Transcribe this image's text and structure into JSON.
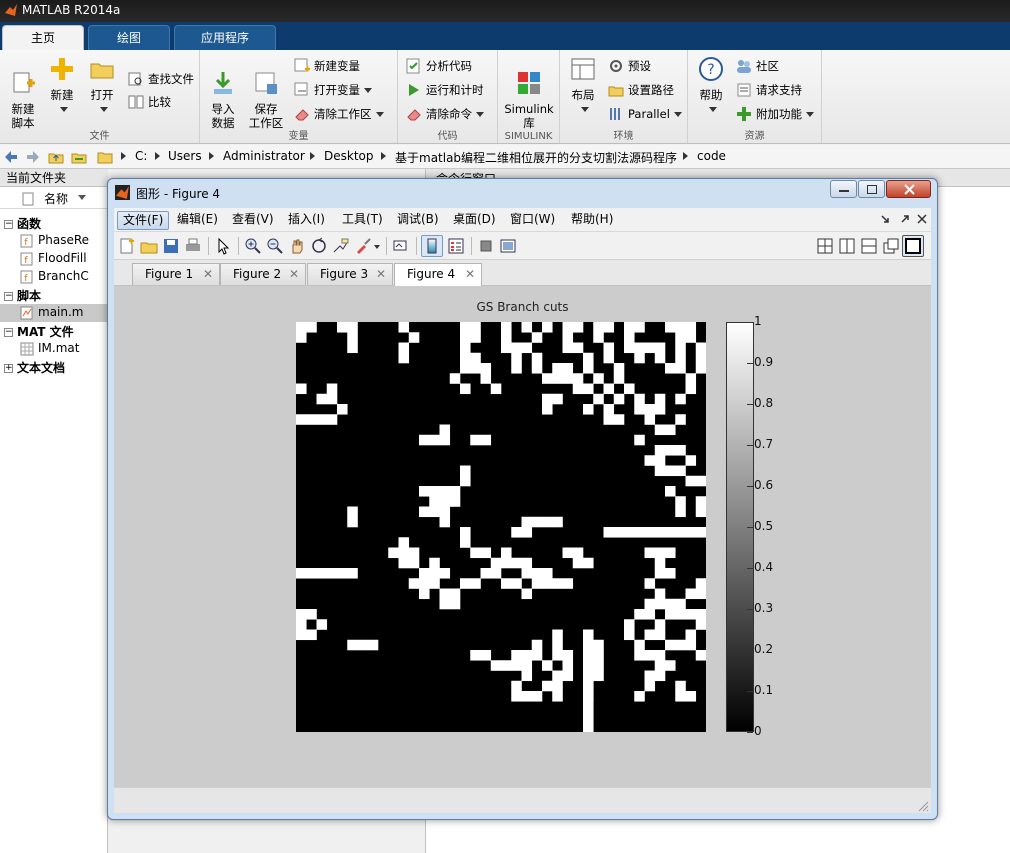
{
  "app": {
    "title": "MATLAB R2014a"
  },
  "ribbon": {
    "tabs": [
      {
        "label": "主页",
        "active": true
      },
      {
        "label": "绘图",
        "active": false
      },
      {
        "label": "应用程序",
        "active": false
      }
    ],
    "groups": {
      "file": {
        "label": "文件",
        "new_script": "新建\n脚本",
        "new": "新建",
        "open": "打开",
        "find_files": "查找文件",
        "compare": "比较"
      },
      "variable": {
        "label": "变量",
        "import": "导入\n数据",
        "save_ws": "保存\n工作区",
        "new_var": "新建变量",
        "open_var": "打开变量",
        "clear_ws": "清除工作区"
      },
      "code": {
        "label": "代码",
        "analyze": "分析代码",
        "run_time": "运行和计时",
        "clear_cmd": "清除命令"
      },
      "simulink": {
        "label": "SIMULINK",
        "lib": "Simulink\n库"
      },
      "env": {
        "label": "环境",
        "layout": "布局",
        "prefs": "预设",
        "set_path": "设置路径",
        "parallel": "Parallel"
      },
      "resources": {
        "label": "资源",
        "help": "帮助",
        "community": "社区",
        "support": "请求支持",
        "addons": "附加功能"
      }
    }
  },
  "address": {
    "crumbs": [
      "C:",
      "Users",
      "Administrator",
      "Desktop",
      "基于matlab编程二维相位展开的分支切割法源码程序",
      "code"
    ]
  },
  "file_panel": {
    "title": "当前文件夹",
    "col_name": "名称",
    "sections": [
      {
        "label": "函数",
        "files": [
          "PhaseRe",
          "FloodFill",
          "BranchC"
        ]
      },
      {
        "label": "脚本",
        "files": [
          "main.m"
        ]
      },
      {
        "label": "MAT 文件",
        "files": [
          "IM.mat"
        ]
      },
      {
        "label": "文本文档",
        "files": []
      }
    ]
  },
  "command_window": {
    "title": "命令行窗口"
  },
  "figure": {
    "window_title": "图形 - Figure 4",
    "menu": [
      "文件(F)",
      "编辑(E)",
      "查看(V)",
      "插入(I)",
      "工具(T)",
      "调试(B)",
      "桌面(D)",
      "窗口(W)",
      "帮助(H)"
    ],
    "tabs": [
      {
        "label": "Figure 1",
        "active": false
      },
      {
        "label": "Figure 2",
        "active": false
      },
      {
        "label": "Figure 3",
        "active": false
      },
      {
        "label": "Figure 4",
        "active": true
      }
    ],
    "plot_title": "GS Branch cuts"
  },
  "chart_data": {
    "type": "heatmap",
    "title": "GS Branch cuts",
    "colormap": "gray",
    "colorbar_ticks": [
      "0",
      "0.1",
      "0.2",
      "0.3",
      "0.4",
      "0.5",
      "0.6",
      "0.7",
      "0.8",
      "0.9",
      "1"
    ],
    "clim": [
      0,
      1
    ],
    "grid_size": 40,
    "white_cells": [
      [
        1,
        1
      ],
      [
        1,
        2
      ],
      [
        2,
        1
      ],
      [
        1,
        5
      ],
      [
        1,
        6
      ],
      [
        1,
        11
      ],
      [
        2,
        12
      ],
      [
        3,
        11
      ],
      [
        4,
        11
      ],
      [
        3,
        6
      ],
      [
        2,
        6
      ],
      [
        1,
        17
      ],
      [
        2,
        17
      ],
      [
        3,
        17
      ],
      [
        4,
        17
      ],
      [
        2,
        18
      ],
      [
        1,
        21
      ],
      [
        2,
        21
      ],
      [
        3,
        21
      ],
      [
        1,
        23
      ],
      [
        1,
        27
      ],
      [
        2,
        27
      ],
      [
        3,
        27
      ],
      [
        1,
        28
      ],
      [
        1,
        30
      ],
      [
        2,
        30
      ],
      [
        3,
        31
      ],
      [
        1,
        31
      ],
      [
        1,
        33
      ],
      [
        2,
        33
      ],
      [
        3,
        33
      ],
      [
        1,
        34
      ],
      [
        1,
        37
      ],
      [
        1,
        38
      ],
      [
        2,
        38
      ],
      [
        3,
        38
      ],
      [
        1,
        39
      ],
      [
        2,
        39
      ],
      [
        1,
        25
      ],
      [
        2,
        24
      ],
      [
        1,
        18
      ],
      [
        3,
        22
      ],
      [
        3,
        23
      ],
      [
        4,
        22
      ],
      [
        3,
        28
      ],
      [
        4,
        29
      ],
      [
        5,
        29
      ],
      [
        4,
        31
      ],
      [
        5,
        32
      ],
      [
        3,
        34
      ],
      [
        4,
        34
      ],
      [
        3,
        35
      ],
      [
        4,
        36
      ],
      [
        3,
        36
      ],
      [
        5,
        37
      ],
      [
        4,
        38
      ],
      [
        5,
        38
      ],
      [
        5,
        40
      ],
      [
        4,
        40
      ],
      [
        3,
        40
      ],
      [
        6,
        39
      ],
      [
        5,
        17
      ],
      [
        4,
        18
      ],
      [
        5,
        18
      ],
      [
        5,
        19
      ],
      [
        6,
        19
      ],
      [
        7,
        20
      ],
      [
        5,
        24
      ],
      [
        6,
        25
      ],
      [
        5,
        26
      ],
      [
        6,
        26
      ],
      [
        6,
        27
      ],
      [
        5,
        27
      ],
      [
        6,
        28
      ],
      [
        7,
        28
      ],
      [
        5,
        22
      ],
      [
        4,
        24
      ],
      [
        7,
        1
      ],
      [
        8,
        3
      ],
      [
        8,
        4
      ],
      [
        9,
        5
      ],
      [
        7,
        4
      ],
      [
        6,
        16
      ],
      [
        7,
        17
      ],
      [
        8,
        25
      ],
      [
        8,
        26
      ],
      [
        9,
        25
      ],
      [
        7,
        31
      ],
      [
        8,
        32
      ],
      [
        8,
        34
      ],
      [
        9,
        35
      ],
      [
        8,
        36
      ],
      [
        9,
        36
      ],
      [
        7,
        33
      ],
      [
        8,
        38
      ],
      [
        7,
        39
      ],
      [
        6,
        32
      ],
      [
        7,
        29
      ],
      [
        8,
        30
      ],
      [
        6,
        30
      ],
      [
        10,
        1
      ],
      [
        10,
        2
      ],
      [
        10,
        3
      ],
      [
        10,
        4
      ],
      [
        9,
        29
      ],
      [
        9,
        31
      ],
      [
        10,
        31
      ],
      [
        10,
        32
      ],
      [
        9,
        34
      ],
      [
        10,
        35
      ],
      [
        11,
        36
      ],
      [
        11,
        37
      ],
      [
        10,
        38
      ],
      [
        12,
        13
      ],
      [
        12,
        14
      ],
      [
        12,
        15
      ],
      [
        11,
        15
      ],
      [
        12,
        18
      ],
      [
        12,
        19
      ],
      [
        12,
        34
      ],
      [
        13,
        36
      ],
      [
        13,
        37
      ],
      [
        14,
        35
      ],
      [
        14,
        36
      ],
      [
        13,
        38
      ],
      [
        14,
        39
      ],
      [
        15,
        36
      ],
      [
        15,
        37
      ],
      [
        15,
        38
      ],
      [
        16,
        39
      ],
      [
        16,
        40
      ],
      [
        15,
        17
      ],
      [
        16,
        17
      ],
      [
        17,
        14
      ],
      [
        17,
        15
      ],
      [
        17,
        16
      ],
      [
        18,
        14
      ],
      [
        18,
        15
      ],
      [
        17,
        13
      ],
      [
        18,
        16
      ],
      [
        19,
        14
      ],
      [
        19,
        13
      ],
      [
        17,
        37
      ],
      [
        18,
        38
      ],
      [
        19,
        38
      ],
      [
        18,
        40
      ],
      [
        19,
        40
      ],
      [
        19,
        6
      ],
      [
        20,
        6
      ],
      [
        19,
        15
      ],
      [
        20,
        15
      ],
      [
        20,
        23
      ],
      [
        20,
        24
      ],
      [
        20,
        25
      ],
      [
        20,
        26
      ],
      [
        21,
        22
      ],
      [
        21,
        23
      ],
      [
        21,
        17
      ],
      [
        22,
        17
      ],
      [
        21,
        31
      ],
      [
        21,
        32
      ],
      [
        21,
        33
      ],
      [
        21,
        34
      ],
      [
        21,
        35
      ],
      [
        21,
        36
      ],
      [
        21,
        37
      ],
      [
        21,
        38
      ],
      [
        21,
        39
      ],
      [
        21,
        40
      ],
      [
        22,
        11
      ],
      [
        23,
        11
      ],
      [
        23,
        12
      ],
      [
        23,
        10
      ],
      [
        24,
        11
      ],
      [
        24,
        12
      ],
      [
        23,
        18
      ],
      [
        23,
        19
      ],
      [
        23,
        21
      ],
      [
        23,
        27
      ],
      [
        23,
        28
      ],
      [
        24,
        28
      ],
      [
        24,
        29
      ],
      [
        24,
        21
      ],
      [
        24,
        20
      ],
      [
        25,
        19
      ],
      [
        24,
        22
      ],
      [
        24,
        23
      ],
      [
        23,
        35
      ],
      [
        23,
        36
      ],
      [
        23,
        37
      ],
      [
        24,
        36
      ],
      [
        25,
        36
      ],
      [
        25,
        37
      ],
      [
        25,
        13
      ],
      [
        26,
        13
      ],
      [
        26,
        14
      ],
      [
        27,
        13
      ],
      [
        25,
        14
      ],
      [
        25,
        24
      ],
      [
        26,
        24
      ],
      [
        26,
        25
      ],
      [
        25,
        25
      ],
      [
        25,
        23
      ],
      [
        26,
        18
      ],
      [
        26,
        17
      ],
      [
        27,
        16
      ],
      [
        27,
        15
      ],
      [
        28,
        16
      ],
      [
        28,
        15
      ],
      [
        26,
        12
      ],
      [
        25,
        15
      ],
      [
        24,
        14
      ],
      [
        25,
        1
      ],
      [
        25,
        2
      ],
      [
        25,
        3
      ],
      [
        25,
        4
      ],
      [
        25,
        5
      ],
      [
        25,
        6
      ],
      [
        26,
        21
      ],
      [
        25,
        20
      ],
      [
        26,
        22
      ],
      [
        27,
        23
      ],
      [
        26,
        26
      ],
      [
        26,
        27
      ],
      [
        27,
        39
      ],
      [
        26,
        40
      ],
      [
        27,
        40
      ],
      [
        26,
        35
      ],
      [
        27,
        36
      ],
      [
        28,
        36
      ],
      [
        29,
        1
      ],
      [
        29,
        2
      ],
      [
        30,
        1
      ],
      [
        31,
        1
      ],
      [
        31,
        2
      ],
      [
        30,
        3
      ],
      [
        28,
        35
      ],
      [
        29,
        35
      ],
      [
        28,
        37
      ],
      [
        29,
        37
      ],
      [
        29,
        38
      ],
      [
        29,
        39
      ],
      [
        29,
        40
      ],
      [
        30,
        40
      ],
      [
        28,
        38
      ],
      [
        29,
        34
      ],
      [
        30,
        33
      ],
      [
        31,
        33
      ],
      [
        30,
        36
      ],
      [
        31,
        36
      ],
      [
        31,
        35
      ],
      [
        32,
        6
      ],
      [
        32,
        7
      ],
      [
        32,
        8
      ],
      [
        32,
        29
      ],
      [
        31,
        29
      ],
      [
        32,
        30
      ],
      [
        33,
        29
      ],
      [
        33,
        30
      ],
      [
        31,
        26
      ],
      [
        32,
        26
      ],
      [
        33,
        24
      ],
      [
        32,
        24
      ],
      [
        33,
        23
      ],
      [
        33,
        22
      ],
      [
        34,
        22
      ],
      [
        34,
        21
      ],
      [
        34,
        20
      ],
      [
        33,
        19
      ],
      [
        33,
        18
      ],
      [
        32,
        34
      ],
      [
        33,
        34
      ],
      [
        33,
        35
      ],
      [
        33,
        36
      ],
      [
        34,
        36
      ],
      [
        34,
        37
      ],
      [
        32,
        38
      ],
      [
        32,
        39
      ],
      [
        33,
        40
      ],
      [
        32,
        37
      ],
      [
        31,
        39
      ],
      [
        34,
        27
      ],
      [
        35,
        27
      ],
      [
        33,
        26
      ],
      [
        34,
        23
      ],
      [
        35,
        23
      ],
      [
        35,
        26
      ],
      [
        34,
        25
      ],
      [
        33,
        27
      ],
      [
        36,
        26
      ],
      [
        37,
        26
      ],
      [
        36,
        25
      ],
      [
        37,
        23
      ],
      [
        37,
        24
      ],
      [
        36,
        22
      ],
      [
        37,
        22
      ],
      [
        35,
        30
      ],
      [
        36,
        29
      ],
      [
        37,
        29
      ],
      [
        34,
        30
      ],
      [
        35,
        36
      ],
      [
        36,
        35
      ],
      [
        37,
        34
      ],
      [
        37,
        38
      ],
      [
        37,
        39
      ],
      [
        36,
        38
      ],
      [
        35,
        35
      ],
      [
        33,
        29
      ],
      [
        34,
        29
      ],
      [
        35,
        29
      ],
      [
        36,
        29
      ],
      [
        37,
        29
      ],
      [
        38,
        29
      ],
      [
        39,
        29
      ],
      [
        40,
        29
      ]
    ]
  }
}
